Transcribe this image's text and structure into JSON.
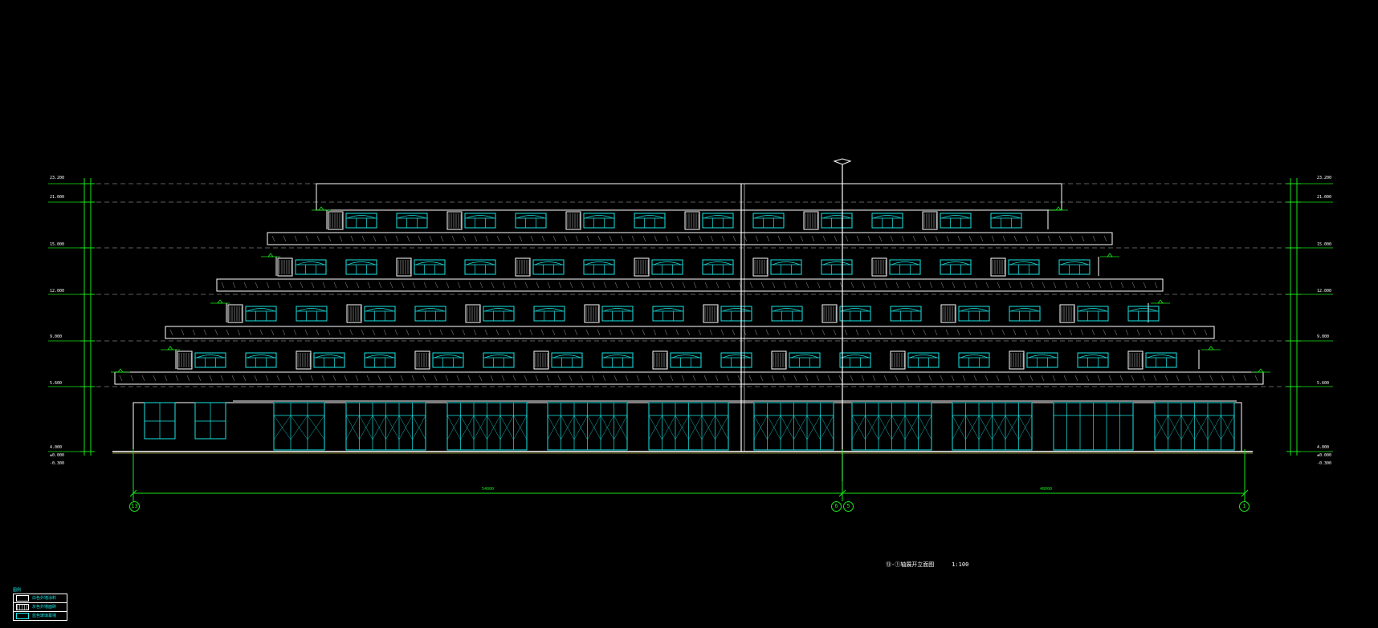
{
  "drawing": {
    "colors": {
      "background": "#000000",
      "outline": "#ffffff",
      "dimension": "#19e619",
      "glazing": "#19e6e6"
    },
    "axis_bubbles": {
      "left": "13",
      "center_a": "6",
      "center_b": "5",
      "right": "1"
    },
    "overall_dims": {
      "left_span": "54000",
      "right_span": "48000"
    },
    "title": {
      "text": "⑬-①轴展开立面图",
      "scale": "1:100"
    },
    "elev_left": [
      "23.200",
      "21.000",
      "15.000",
      "12.000",
      "9.000",
      "5.600",
      "4.000",
      "±0.000",
      "-0.300"
    ],
    "elev_right": [
      "23.200",
      "21.000",
      "15.000",
      "12.000",
      "9.000",
      "5.600",
      "4.000",
      "±0.000",
      "-0.300"
    ],
    "legend": {
      "head": "图例",
      "items": [
        "白色外墙涂料",
        "灰色外墙面砖",
        "蓝色玻璃幕墙"
      ]
    }
  }
}
